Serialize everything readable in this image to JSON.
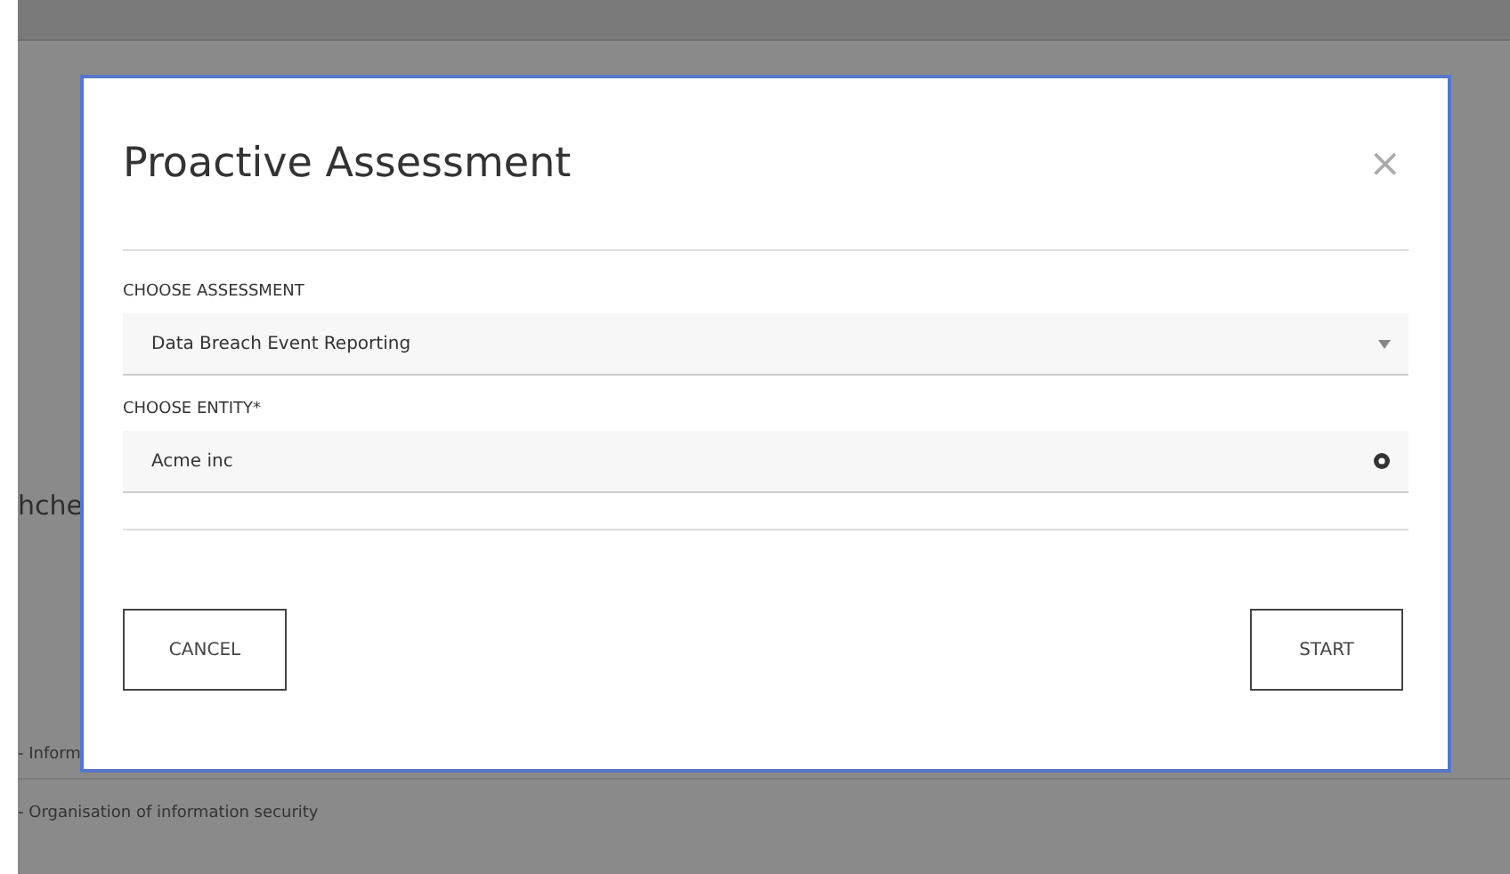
{
  "background": {
    "heading": "hche",
    "rows": [
      "- Inform",
      "- Organisation of information security"
    ]
  },
  "dialog": {
    "title": "Proactive Assessment",
    "close": "×",
    "fields": [
      {
        "label": "CHOOSE ASSESSMENT",
        "value": "Data Breach Event Reporting",
        "kind": "dropdown"
      },
      {
        "label": "CHOOSE ENTITY*",
        "value": "Acme inc",
        "kind": "lookup"
      }
    ],
    "buttons": [
      "CANCEL",
      "START"
    ]
  }
}
